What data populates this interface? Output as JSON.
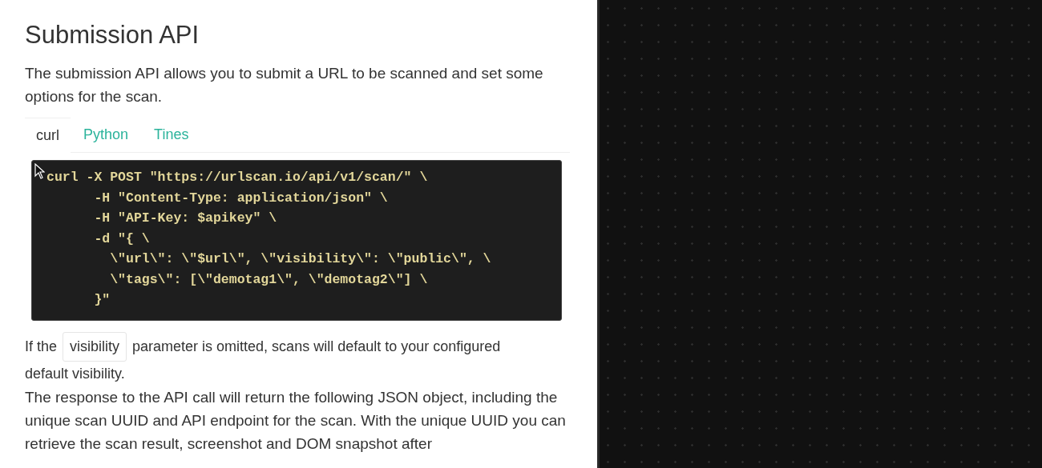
{
  "heading": "Submission API",
  "intro": "The submission API allows you to submit a URL to be scanned and set some options for the scan.",
  "tabs": [
    {
      "label": "curl",
      "selected": true
    },
    {
      "label": "Python",
      "selected": false
    },
    {
      "label": "Tines",
      "selected": false
    }
  ],
  "code_lines": [
    "curl -X POST \"https://urlscan.io/api/v1/scan/\" \\",
    "      -H \"Content-Type: application/json\" \\",
    "      -H \"API-Key: $apikey\" \\",
    "      -d \"{ \\",
    "        \\\"url\\\": \\\"$url\\\", \\\"visibility\\\": \\\"public\\\", \\",
    "        \\\"tags\\\": [\\\"demotag1\\\", \\\"demotag2\\\"] \\",
    "      }\""
  ],
  "note": {
    "before": "If the",
    "code": "visibility",
    "after": "parameter is omitted, scans will default to your configured",
    "continuation": "default visibility."
  },
  "response_text": "The response to the API call will return the following JSON object, including the unique scan UUID and API endpoint for the scan. With the unique UUID you can retrieve the scan result, screenshot and DOM snapshot after"
}
